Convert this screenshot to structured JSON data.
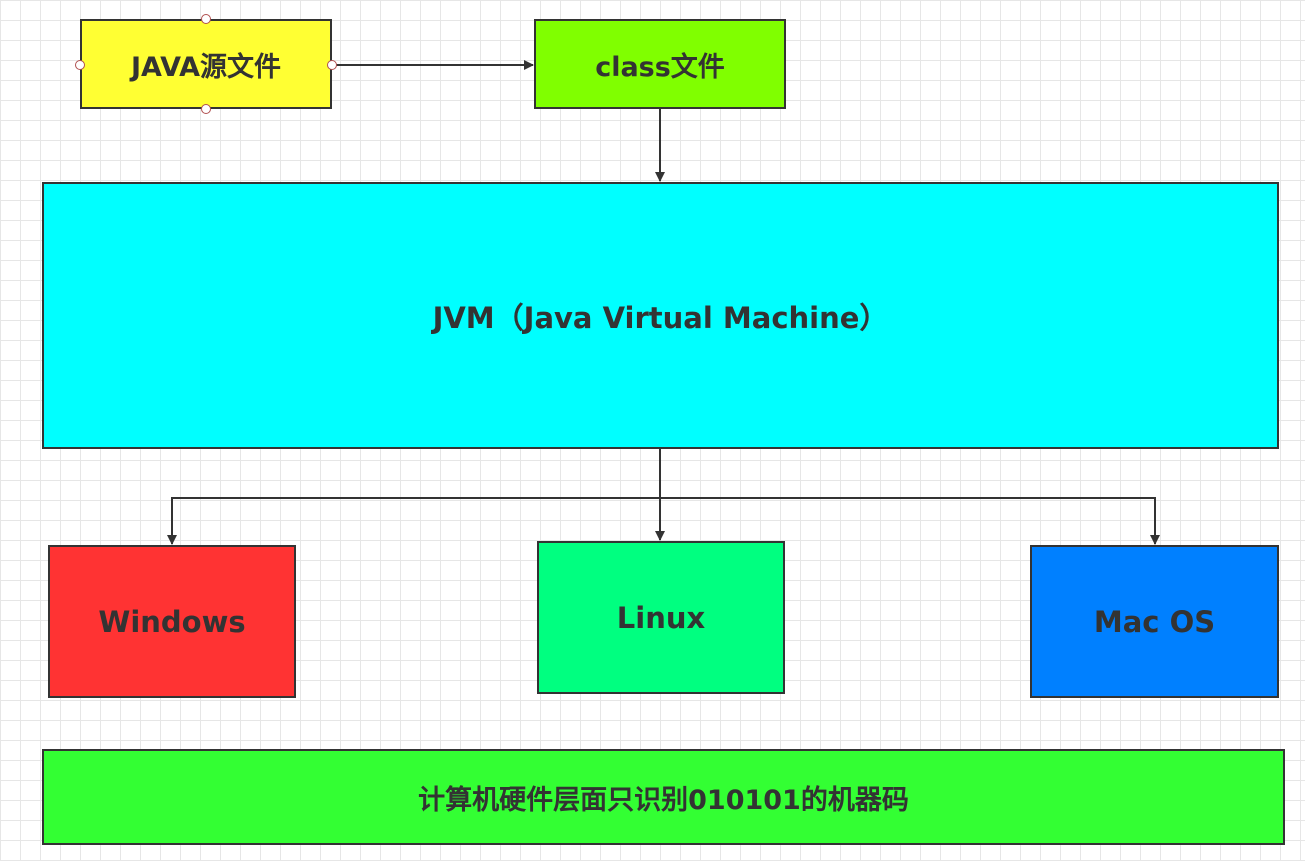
{
  "nodes": {
    "java_source": {
      "label": "JAVA源文件",
      "color": "#ffff33"
    },
    "class_file": {
      "label": "class文件",
      "color": "#80ff00"
    },
    "jvm": {
      "label": "JVM（Java Virtual Machine）",
      "color": "#00ffff"
    },
    "windows": {
      "label": "Windows",
      "color": "#ff3333"
    },
    "linux": {
      "label": "Linux",
      "color": "#00ff80"
    },
    "macos": {
      "label": "Mac OS",
      "color": "#0080ff"
    },
    "hardware": {
      "label": "计算机硬件层面只识别010101的机器码",
      "color": "#33ff33"
    }
  },
  "edges": [
    {
      "from": "java_source",
      "to": "class_file"
    },
    {
      "from": "class_file",
      "to": "jvm"
    },
    {
      "from": "jvm",
      "to": "windows"
    },
    {
      "from": "jvm",
      "to": "linux"
    },
    {
      "from": "jvm",
      "to": "macos"
    }
  ],
  "colors": {
    "line": "#333333",
    "grid": "#e6e6e6",
    "selection_handle": "#b05050"
  }
}
